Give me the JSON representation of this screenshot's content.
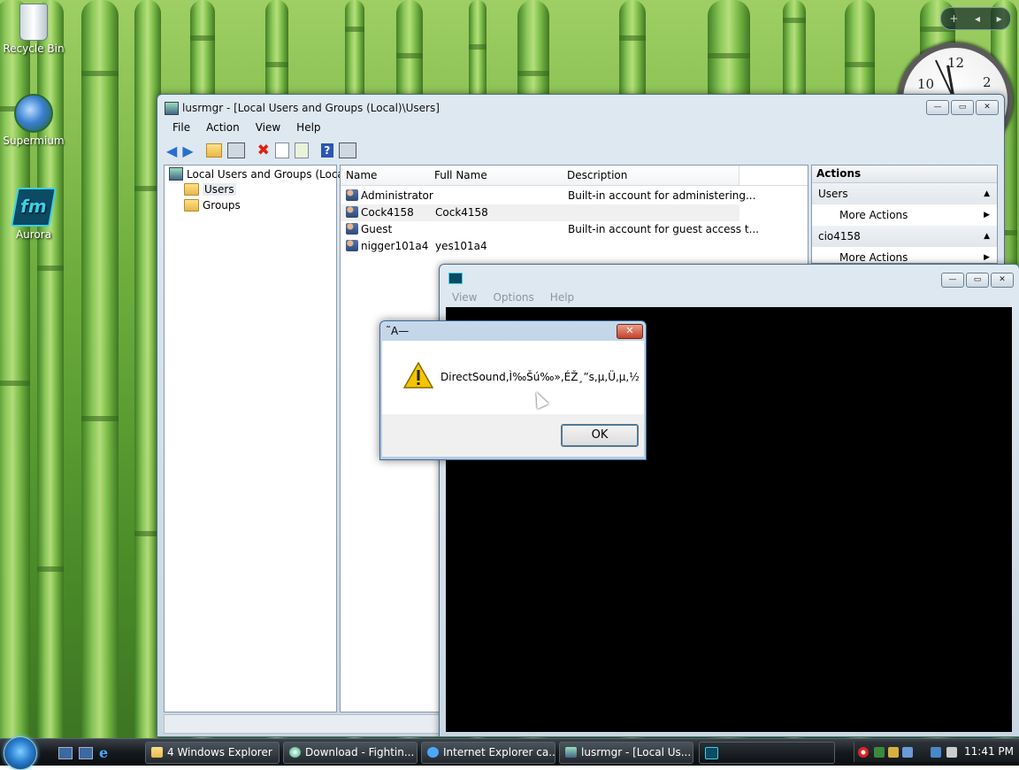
{
  "desktop": {
    "icons": [
      {
        "label": "Recycle Bin",
        "icon": "recycle-bin-icon"
      },
      {
        "label": "Supermium",
        "icon": "supermium-browser-icon"
      },
      {
        "label": "Aurora",
        "icon": "aurora-app-icon"
      }
    ],
    "gadget_bar": {
      "add": "+",
      "prev": "◂",
      "next": "▸"
    },
    "clock_numbers": {
      "n10": "10",
      "n12": "12",
      "n2": "2"
    }
  },
  "lusrmgr": {
    "title": "lusrmgr - [Local Users and Groups (Local)\\Users]",
    "menu": [
      "File",
      "Action",
      "View",
      "Help"
    ],
    "tree": {
      "root": "Local Users and Groups (Local)",
      "children": [
        "Users",
        "Groups"
      ]
    },
    "columns": [
      "Name",
      "Full Name",
      "Description"
    ],
    "rows": [
      {
        "name": "Administrator",
        "full_name": "",
        "description": "Built-in account for administering..."
      },
      {
        "name": "Cock4158",
        "full_name": "Cock4158",
        "description": ""
      },
      {
        "name": "Guest",
        "full_name": "",
        "description": "Built-in account for guest access t..."
      },
      {
        "name": "nigger101a4",
        "full_name": "yes101a4",
        "description": ""
      }
    ],
    "actions": {
      "header": "Actions",
      "sections": [
        {
          "title": "Users",
          "item": "More Actions"
        },
        {
          "title": "cio4158",
          "item": "More Actions"
        }
      ]
    }
  },
  "app_window": {
    "menu": [
      "View",
      "Options",
      "Help"
    ]
  },
  "dialog": {
    "title": "˜A—",
    "message": "DirectSound,Ì‰Šú‰»,ÉŽ¸”s,µ,Ü,µ,½",
    "ok": "OK"
  },
  "taskbar": {
    "buttons": [
      {
        "label": "4 Windows Explorer"
      },
      {
        "label": "Download - Fightin..."
      },
      {
        "label": "Internet Explorer ca..."
      },
      {
        "label": "lusrmgr - [Local Us..."
      },
      {
        "label": ""
      }
    ],
    "time": "11:41 PM"
  }
}
